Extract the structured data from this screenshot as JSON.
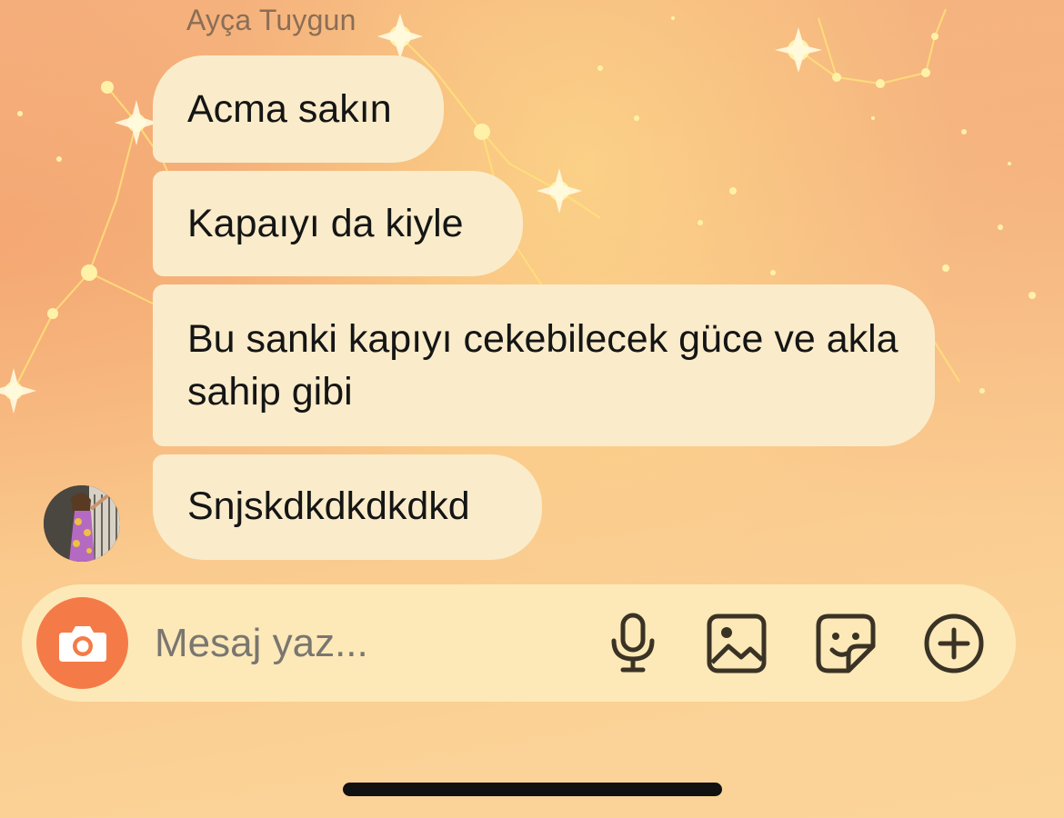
{
  "chat": {
    "sender_name": "Ayça Tuygun",
    "messages": [
      {
        "text": "Acma sakın"
      },
      {
        "text": "Kapaıyı da kiyle"
      },
      {
        "text": "Bu sanki kapıyı cekebilecek güce ve akla sahip gibi"
      },
      {
        "text": "Snjskdkdkdkdkd"
      }
    ]
  },
  "composer": {
    "placeholder": "Mesaj yaz...",
    "icons": [
      "camera-icon",
      "microphone-icon",
      "gallery-icon",
      "sticker-icon",
      "plus-circle-icon"
    ]
  },
  "colors": {
    "bubble": "#faecca",
    "camera_button": "#f47b48",
    "composer_bg": "#fde9b8",
    "icon_stroke": "#3a3325"
  }
}
